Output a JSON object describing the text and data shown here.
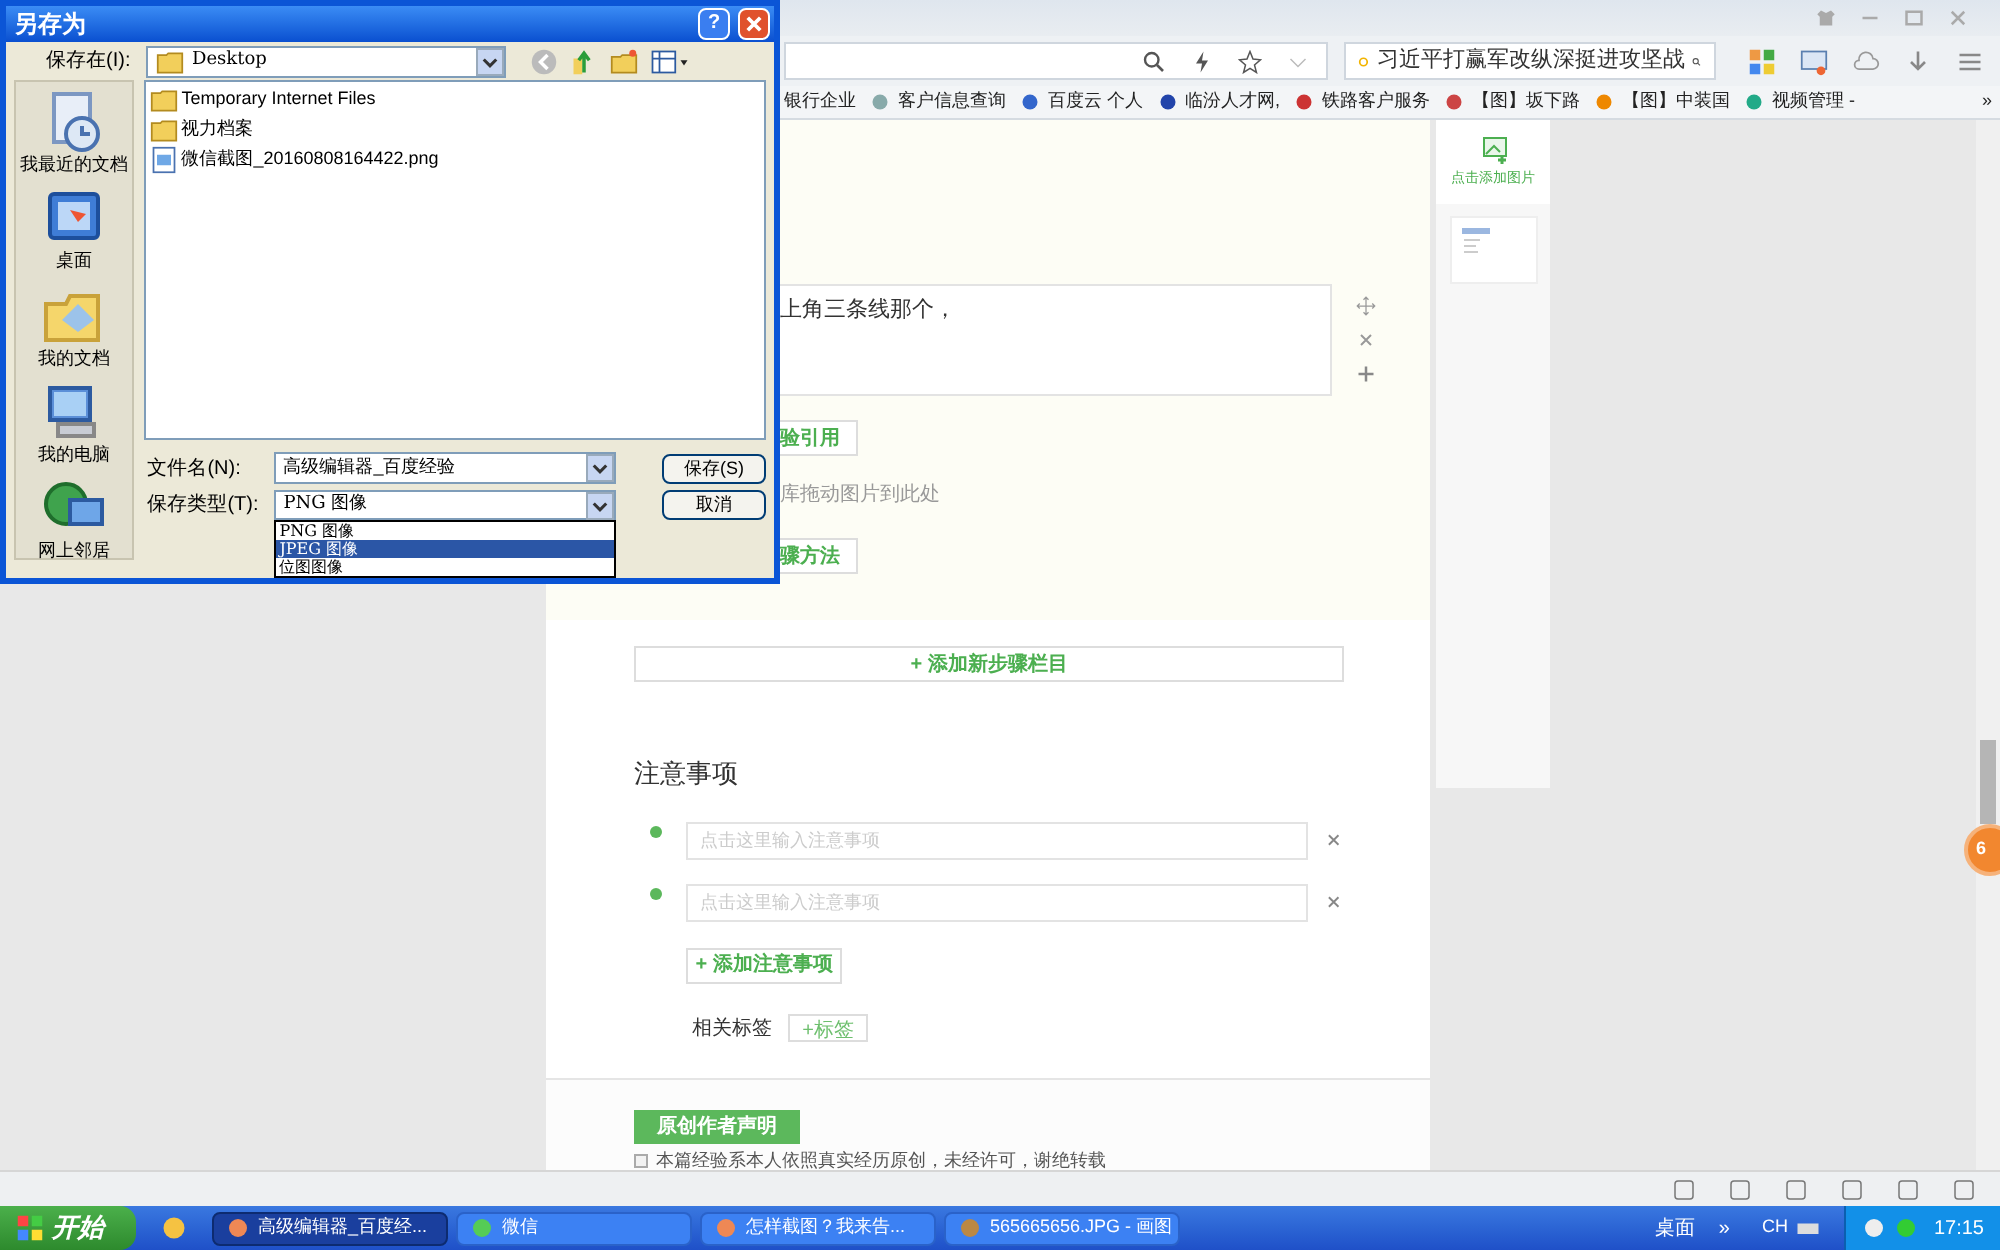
{
  "browser": {
    "search_value": "习近平打赢军改纵深挺进攻坚战",
    "bookmarks": [
      {
        "label": "银行企业"
      },
      {
        "label": "客户信息查询"
      },
      {
        "label": "百度云 个人"
      },
      {
        "label": "临汾人才网,"
      },
      {
        "label": "铁路客户服务"
      },
      {
        "label": "【图】坂下路"
      },
      {
        "label": "【图】中装国"
      },
      {
        "label": "视频管理 -"
      }
    ],
    "more": "»"
  },
  "editor": {
    "step_text": "上角三条线那个，",
    "step_buttons": [
      "验引用",
      "骤方法"
    ],
    "drop_hint": "库拖动图片到此处",
    "add_step": "+ 添加新步骤栏目",
    "notes_title": "注意事项",
    "notes": [
      {
        "placeholder": "点击这里输入注意事项"
      },
      {
        "placeholder": "点击这里输入注意事项"
      }
    ],
    "add_note": "+ 添加注意事项",
    "tags_label": "相关标签",
    "add_tag": "+标签",
    "declaration_button": "原创作者声明",
    "declaration": {
      "text": "本篇经验系本人依照真实经历原创，未经许可，谢绝转载",
      "checked": false
    }
  },
  "side_panel": {
    "add_image": "点击添加图片"
  },
  "badge": "6",
  "dialog": {
    "title": "另存为",
    "help": "?",
    "save_in_label": "保存在(I):",
    "save_in_value": "Desktop",
    "places": [
      "我最近的文档",
      "桌面",
      "我的文档",
      "我的电脑",
      "网上邻居"
    ],
    "files": [
      {
        "name": "Temporary Internet Files",
        "kind": "folder"
      },
      {
        "name": "视力档案",
        "kind": "folder"
      },
      {
        "name": "微信截图_20160808164422.png",
        "kind": "image"
      }
    ],
    "filename_label": "文件名(N):",
    "filename_value": "高级编辑器_百度经验",
    "filetype_label": "保存类型(T):",
    "filetype_value": "PNG 图像",
    "filetype_options": [
      {
        "label": "PNG 图像",
        "selected": false
      },
      {
        "label": "JPEG 图像",
        "selected": true
      },
      {
        "label": "位图图像",
        "selected": false
      }
    ],
    "buttons": [
      "保存(S)",
      "取消"
    ]
  },
  "taskbar": {
    "start": "开始",
    "tasks": [
      {
        "label": "高级编辑器_百度经...",
        "selected": true
      },
      {
        "label": "微信",
        "selected": false
      },
      {
        "label": "怎样截图？我来告...",
        "selected": false
      },
      {
        "label": "565665656.JPG - 画图",
        "selected": false
      }
    ],
    "desktop": "桌面",
    "more": "»",
    "lang": "CH",
    "time": "17:15"
  }
}
